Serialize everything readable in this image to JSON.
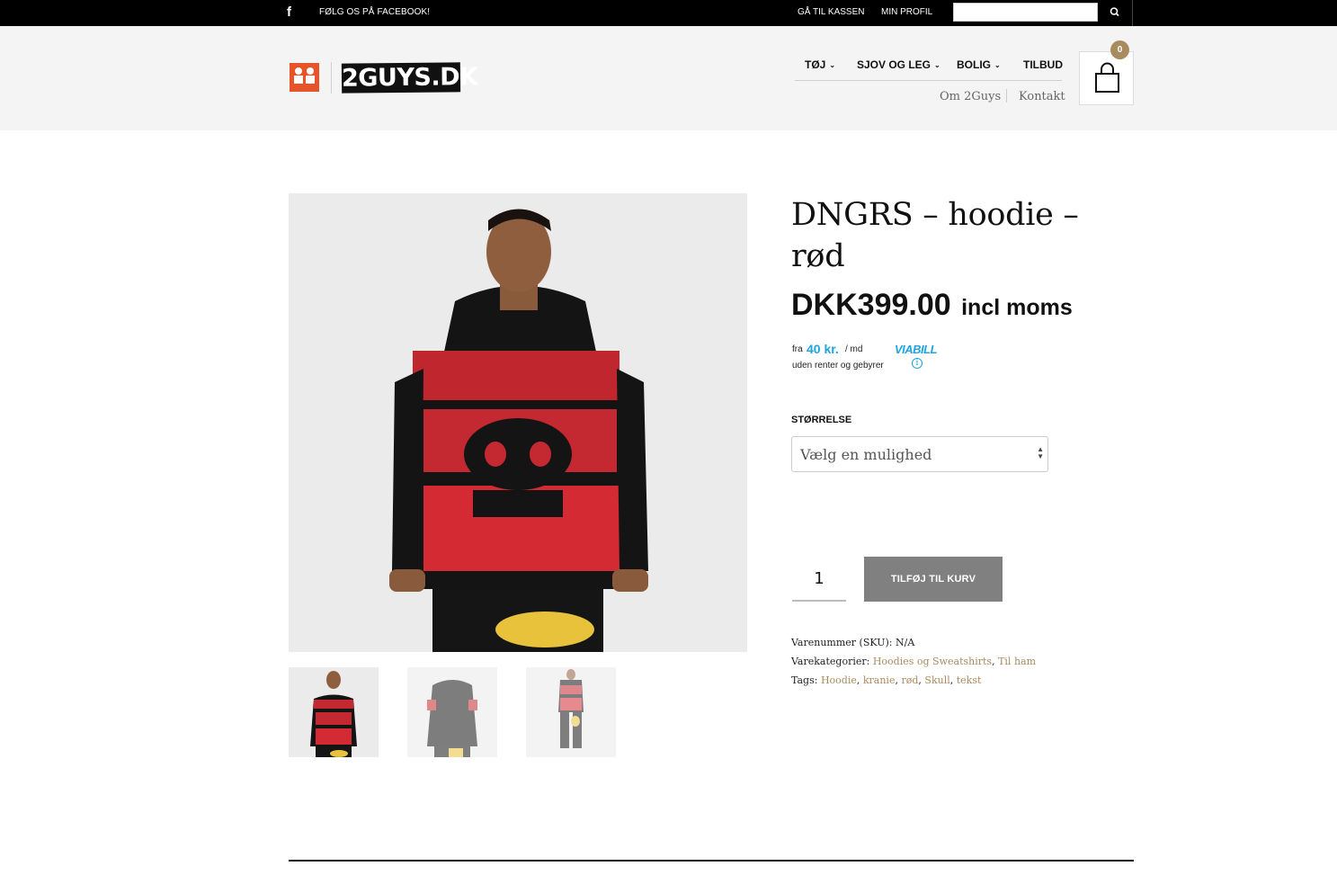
{
  "topbar": {
    "facebook_text": "FØLG OS PÅ FACEBOOK!",
    "checkout_link": "GÅ TIL KASSEN",
    "profile_link": "MIN PROFIL",
    "search_value": ""
  },
  "header": {
    "logo_mark_text": "2GUYS",
    "logo_text": "2GUYS.DK",
    "nav": {
      "item_1": "TØJ",
      "item_2": "SJOV OG LEG",
      "item_3": "BOLIG",
      "item_4": "TILBUD"
    },
    "subnav": {
      "item_1": "Om 2Guys",
      "item_2": "Kontakt"
    },
    "cart_count": "0"
  },
  "product": {
    "title": "DNGRS – hoodie – rød",
    "price": "DKK399.00",
    "price_suffix": "incl moms",
    "viabill": {
      "fra": "fra",
      "amount": "40 kr.",
      "per_month": "/ md",
      "logo": "VIABILL",
      "line2": "uden renter og gebyrer",
      "info_icon": "info-icon"
    },
    "size_label": "STØRRELSE",
    "size_select_value": "Vælg en mulighed",
    "quantity": "1",
    "add_to_cart": "TILFØJ TIL KURV",
    "sku_label": "Varenummer (SKU):",
    "sku_value": "N/A",
    "categories_label": "Varekategorier:",
    "categories": {
      "cat_1": "Hoodies og Sweatshirts",
      "cat_2": "Til ham"
    },
    "tags_label": "Tags:",
    "tags": {
      "tag_1": "Hoodie",
      "tag_2": "kranie",
      "tag_3": "rød",
      "tag_4": "Skull",
      "tag_5": "tekst"
    }
  },
  "colors": {
    "accent_gold": "#a88c5e",
    "viabill_blue": "#1fa4e0",
    "button_gray": "#808080"
  }
}
